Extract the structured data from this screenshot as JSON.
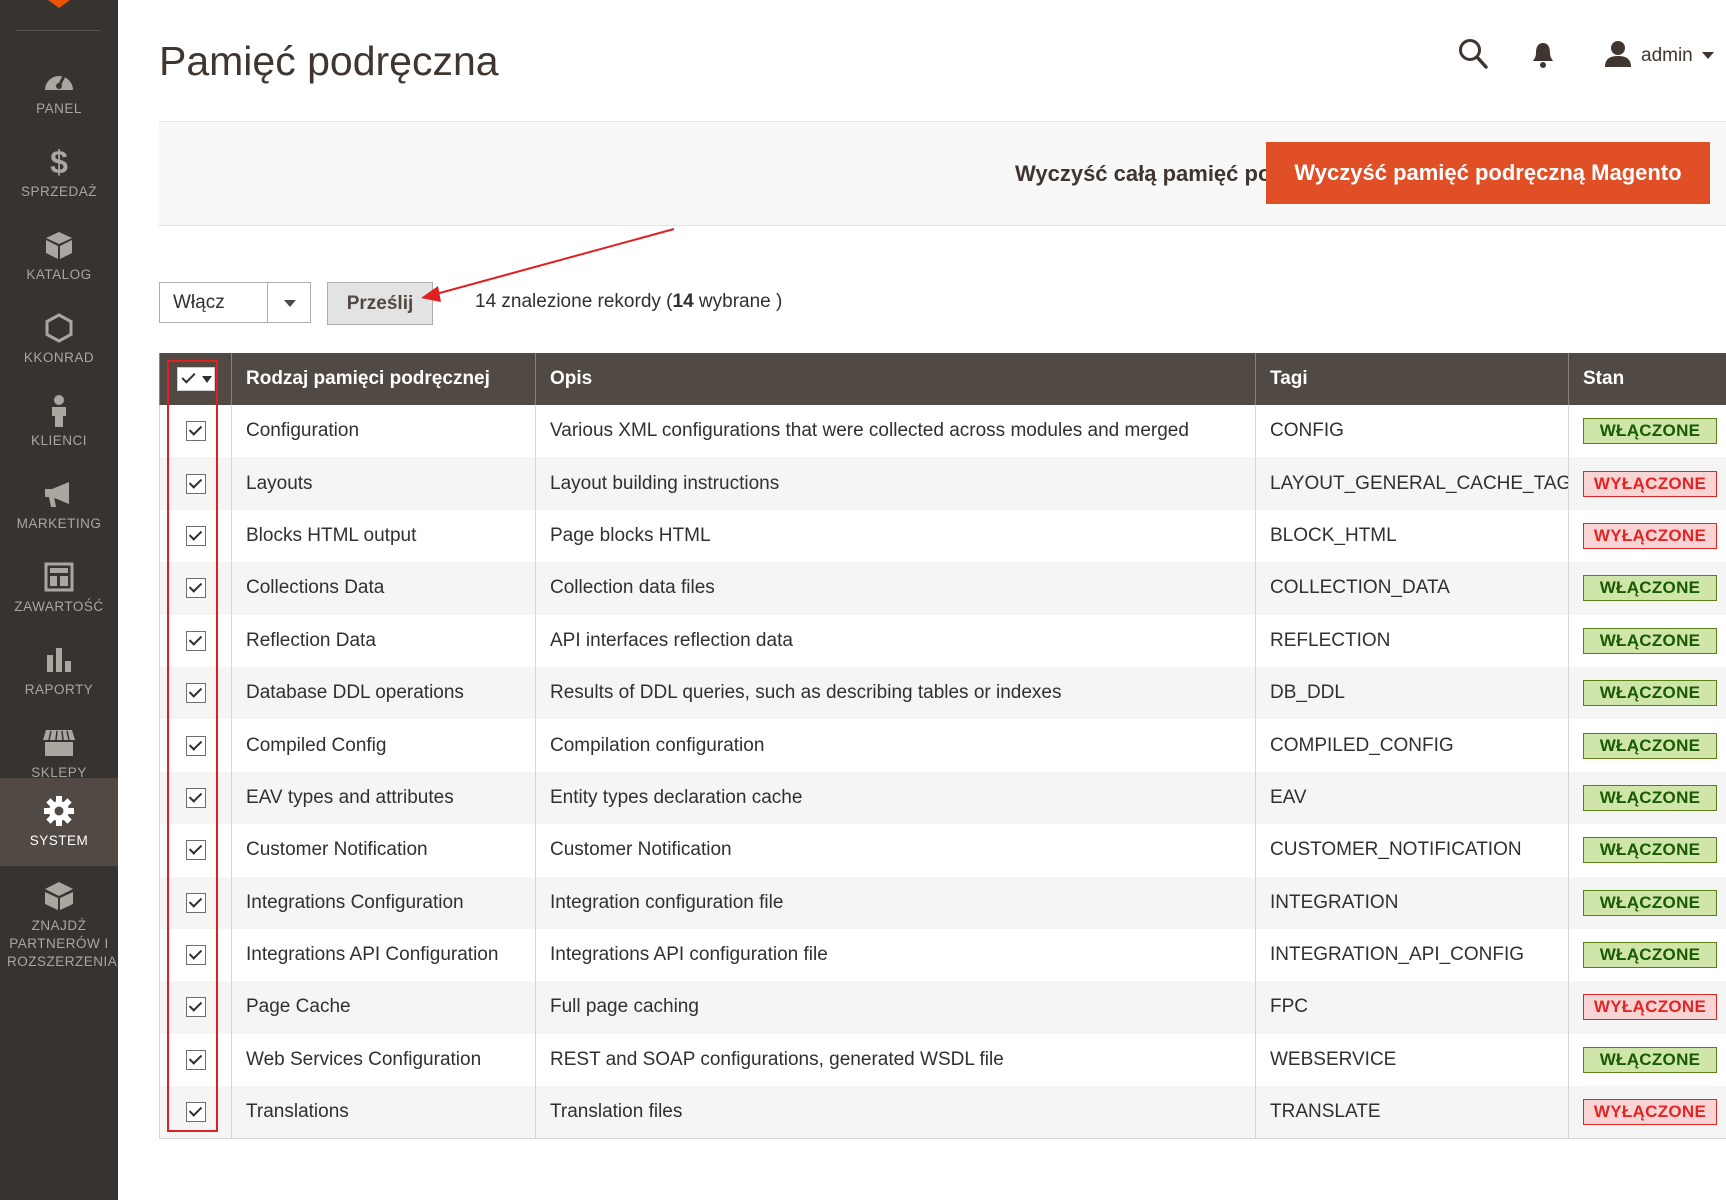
{
  "sidebar": {
    "items": [
      {
        "label": "PANEL",
        "icon": "dashboard-icon",
        "active": false
      },
      {
        "label": "SPRZEDAŻ",
        "icon": "dollar-icon",
        "active": false
      },
      {
        "label": "KATALOG",
        "icon": "box-icon",
        "active": false
      },
      {
        "label": "KKONRAD",
        "icon": "hexagon-icon",
        "active": false
      },
      {
        "label": "KLIENCI",
        "icon": "person-icon",
        "active": false
      },
      {
        "label": "MARKETING",
        "icon": "megaphone-icon",
        "active": false
      },
      {
        "label": "ZAWARTOŚĆ",
        "icon": "layout-icon",
        "active": false
      },
      {
        "label": "RAPORTY",
        "icon": "bar-chart-icon",
        "active": false
      },
      {
        "label": "SKLEPY",
        "icon": "store-icon",
        "active": false
      },
      {
        "label": "SYSTEM",
        "icon": "gear-icon",
        "active": true
      },
      {
        "label": "ZNAJDŹ PARTNERÓW I ROZSZERZENIA",
        "icon": "extensions-icon",
        "active": false
      }
    ]
  },
  "header": {
    "title": "Pamięć podręczna",
    "user": "admin"
  },
  "actions": {
    "flush_all": "Wyczyść całą pamięć podręczną",
    "flush_magento": "Wyczyść pamięć podręczną Magento"
  },
  "mass_action": {
    "selected": "Włącz",
    "submit": "Prześlij",
    "records_prefix": "14 znalezione rekordy (",
    "records_selected": "14",
    "records_suffix": " wybrane )"
  },
  "table": {
    "columns": [
      "Rodzaj pamięci podręcznej",
      "Opis",
      "Tagi",
      "Stan"
    ],
    "rows": [
      {
        "type": "Configuration",
        "desc": "Various XML configurations that were collected across modules and merged",
        "tag": "CONFIG",
        "status": "WŁĄCZONE",
        "enabled": true
      },
      {
        "type": "Layouts",
        "desc": "Layout building instructions",
        "tag": "LAYOUT_GENERAL_CACHE_TAG",
        "status": "WYŁĄCZONE",
        "enabled": false
      },
      {
        "type": "Blocks HTML output",
        "desc": "Page blocks HTML",
        "tag": "BLOCK_HTML",
        "status": "WYŁĄCZONE",
        "enabled": false
      },
      {
        "type": "Collections Data",
        "desc": "Collection data files",
        "tag": "COLLECTION_DATA",
        "status": "WŁĄCZONE",
        "enabled": true
      },
      {
        "type": "Reflection Data",
        "desc": "API interfaces reflection data",
        "tag": "REFLECTION",
        "status": "WŁĄCZONE",
        "enabled": true
      },
      {
        "type": "Database DDL operations",
        "desc": "Results of DDL queries, such as describing tables or indexes",
        "tag": "DB_DDL",
        "status": "WŁĄCZONE",
        "enabled": true
      },
      {
        "type": "Compiled Config",
        "desc": "Compilation configuration",
        "tag": "COMPILED_CONFIG",
        "status": "WŁĄCZONE",
        "enabled": true
      },
      {
        "type": "EAV types and attributes",
        "desc": "Entity types declaration cache",
        "tag": "EAV",
        "status": "WŁĄCZONE",
        "enabled": true
      },
      {
        "type": "Customer Notification",
        "desc": "Customer Notification",
        "tag": "CUSTOMER_NOTIFICATION",
        "status": "WŁĄCZONE",
        "enabled": true
      },
      {
        "type": "Integrations Configuration",
        "desc": "Integration configuration file",
        "tag": "INTEGRATION",
        "status": "WŁĄCZONE",
        "enabled": true
      },
      {
        "type": "Integrations API Configuration",
        "desc": "Integrations API configuration file",
        "tag": "INTEGRATION_API_CONFIG",
        "status": "WŁĄCZONE",
        "enabled": true
      },
      {
        "type": "Page Cache",
        "desc": "Full page caching",
        "tag": "FPC",
        "status": "WYŁĄCZONE",
        "enabled": false
      },
      {
        "type": "Web Services Configuration",
        "desc": "REST and SOAP configurations, generated WSDL file",
        "tag": "WEBSERVICE",
        "status": "WŁĄCZONE",
        "enabled": true
      },
      {
        "type": "Translations",
        "desc": "Translation files",
        "tag": "TRANSLATE",
        "status": "WYŁĄCZONE",
        "enabled": false
      }
    ]
  },
  "colors": {
    "sidebar_bg": "#373330",
    "sidebar_active": "#514943",
    "accent": "#e04f25",
    "table_header": "#514943",
    "annotation": "#e02020"
  }
}
